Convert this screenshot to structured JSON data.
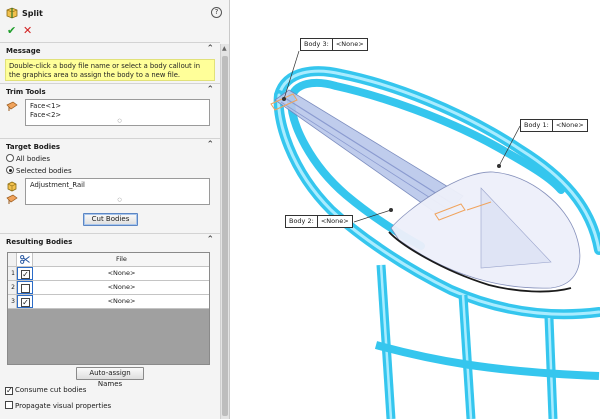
{
  "feature": {
    "title": "Split",
    "help": "?",
    "ok": "✔",
    "cancel": "✕"
  },
  "message": {
    "title": "Message",
    "text": "Double-click a body file name or select a body callout in the graphics area to assign the body to a new file."
  },
  "trim_tools": {
    "title": "Trim Tools",
    "items": [
      "Face<1>",
      "Face<2>"
    ]
  },
  "target_bodies": {
    "title": "Target Bodies",
    "options": [
      "All bodies",
      "Selected bodies"
    ],
    "selected_option": "Selected bodies",
    "items": [
      "Adjustment_Rail"
    ],
    "cut_button": "Cut Bodies"
  },
  "resulting_bodies": {
    "title": "Resulting Bodies",
    "column": "File",
    "rows": [
      {
        "num": "1",
        "checked": true,
        "file": "<None>"
      },
      {
        "num": "2",
        "checked": false,
        "file": "<None>"
      },
      {
        "num": "3",
        "checked": true,
        "file": "<None>"
      }
    ],
    "auto_assign": "Auto-assign Names"
  },
  "options": {
    "consume": {
      "label": "Consume cut bodies",
      "checked": true
    },
    "propagate": {
      "label": "Propagate visual properties",
      "checked": false
    }
  },
  "callouts": [
    {
      "name": "Body 3:",
      "file": "<None>"
    },
    {
      "name": "Body 1:",
      "file": "<None>"
    },
    {
      "name": "Body 2:",
      "file": "<None>"
    }
  ],
  "colors": {
    "rail": "#35c6ee",
    "rail_dark": "#1596c4",
    "body": "#b9c7ea",
    "trim": "#f0a35c",
    "message_bg": "#ffff99"
  },
  "icons": {
    "feature": "split-feature-icon",
    "trim": "trim-face-icon",
    "body": "solid-body-icon",
    "target": "target-body-icon",
    "scissors": "scissors-icon"
  }
}
